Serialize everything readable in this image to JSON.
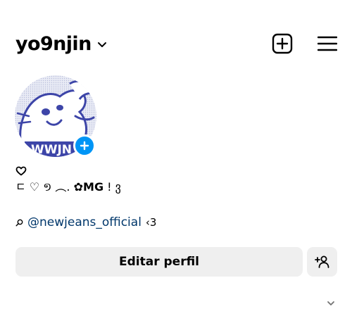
{
  "header": {
    "username": "yo9njin",
    "icons": {
      "dropdown": "chevron-down-icon",
      "create": "plus-square-icon",
      "menu": "hamburger-menu-icon"
    }
  },
  "avatar": {
    "label": "WWJN",
    "add_icon": "plus-circle-icon",
    "accent": "#0095f6"
  },
  "bio": {
    "heart_icon": "heart-outline-icon",
    "line_prefix": "ㄷ ♡  ១ ︵. ",
    "line_bold": "✿MG",
    "line_suffix": " ! ვ",
    "link_icon": "search-icon",
    "mention": "@newjeans_official",
    "mention_suffix": "‹3",
    "mention_color": "#00376b"
  },
  "actions": {
    "edit_label": "Editar perfil",
    "discover_icon": "add-person-icon"
  },
  "footer": {
    "expand_icon": "chevron-down-icon"
  }
}
